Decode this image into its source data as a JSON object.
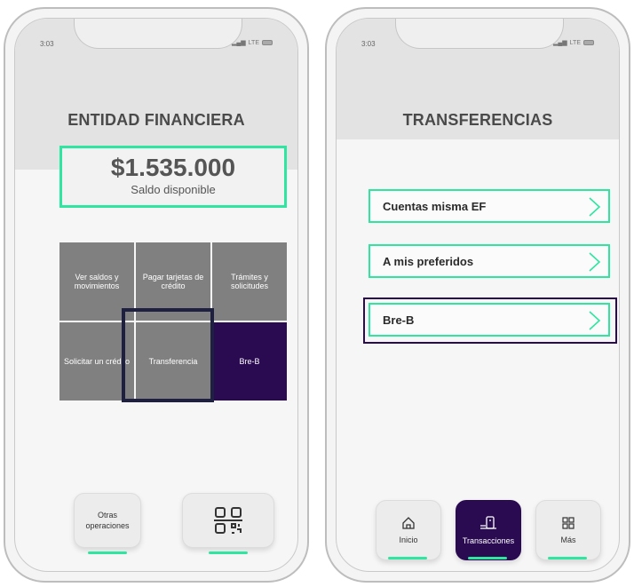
{
  "colors": {
    "accent": "#2ee6a0",
    "brand_dark": "#2a0b52",
    "tile_gray": "#808080",
    "focus": "#1d2041"
  },
  "left_phone": {
    "status": {
      "time": "3:03",
      "network": "LTE"
    },
    "title": "ENTIDAD FINANCIERA",
    "balance": {
      "amount": "$1.535.000",
      "label": "Saldo disponible"
    },
    "grid": [
      {
        "label": "Ver saldos y movimientos"
      },
      {
        "label": "Pagar tarjetas de crédito"
      },
      {
        "label": "Trámites y solicitudes"
      },
      {
        "label": "Solicitar un crédito"
      },
      {
        "label": "Transferencia"
      },
      {
        "label": "Bre-B"
      }
    ],
    "bottom": {
      "other_ops": "Otras operaciones",
      "qr_icon": "qr-code-icon"
    }
  },
  "right_phone": {
    "status": {
      "time": "3:03",
      "network": "LTE"
    },
    "title": "TRANSFERENCIAS",
    "items": [
      {
        "label": "Cuentas misma EF"
      },
      {
        "label": "A mis preferidos"
      },
      {
        "label": "Bre-B"
      }
    ],
    "nav": [
      {
        "label": "Inicio",
        "icon": "home-icon"
      },
      {
        "label": "Transacciones",
        "icon": "transactions-icon"
      },
      {
        "label": "Más",
        "icon": "grid-icon"
      }
    ]
  }
}
